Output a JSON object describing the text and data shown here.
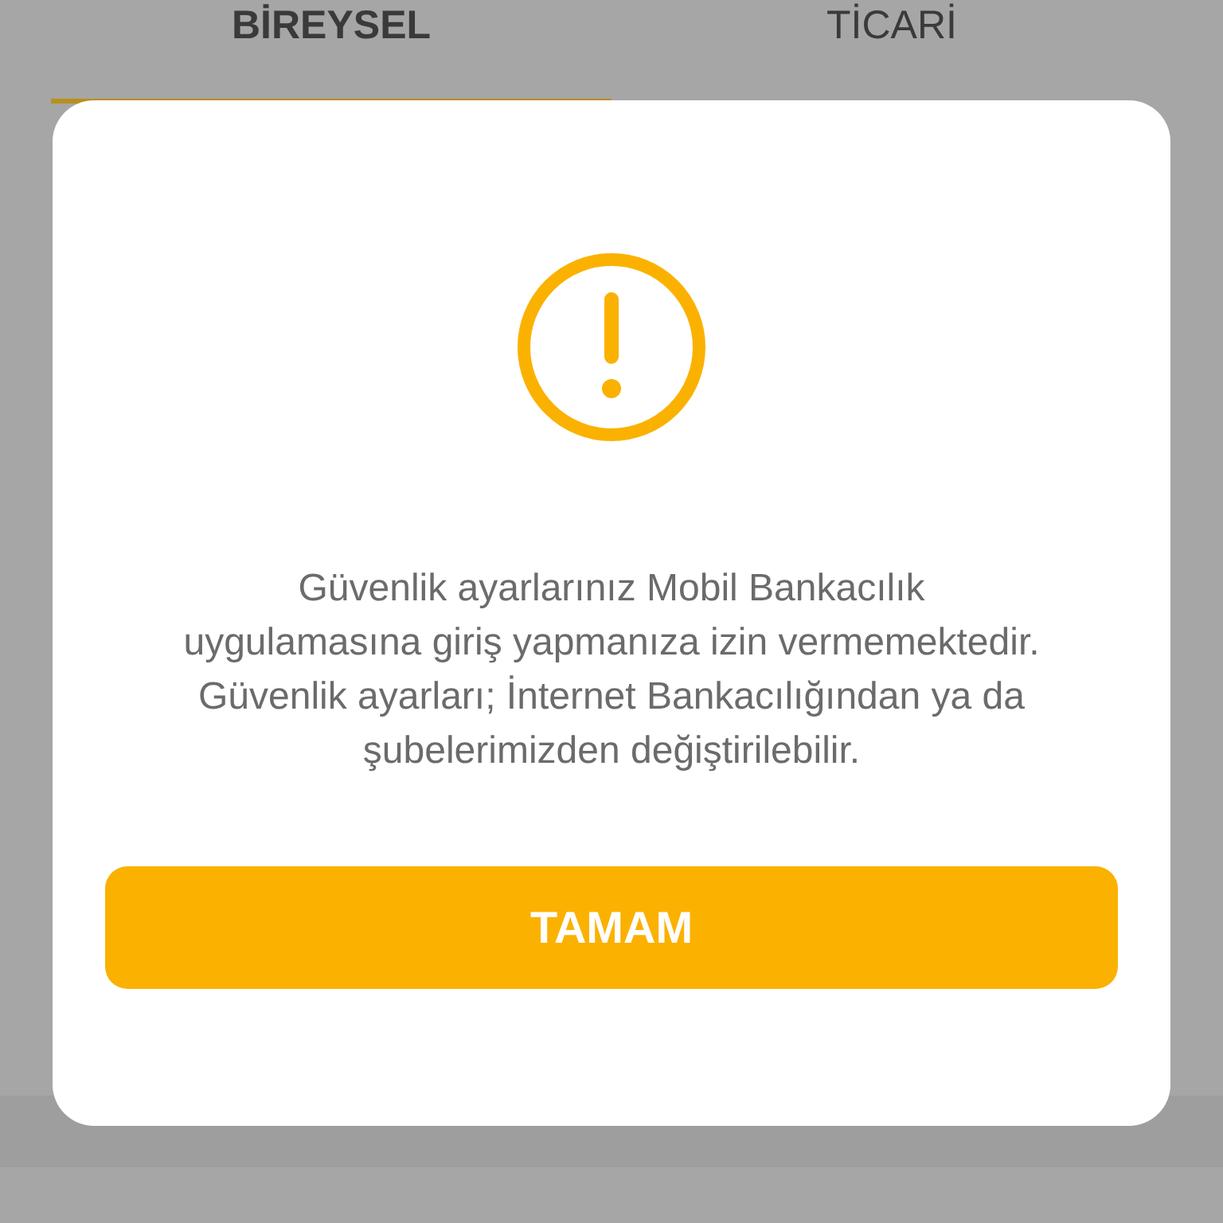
{
  "tabs": [
    {
      "label": "BİREYSEL",
      "selected": true
    },
    {
      "label": "TİCARİ",
      "selected": false
    }
  ],
  "dialog": {
    "message": "Güvenlik ayarlarınız Mobil Bankacılık uygulamasına giriş yapmanıza izin vermemektedir. Güvenlik ayarları; İnternet Bankacılığından ya da şubelerimizden değiştirilebilir.",
    "button": "TAMAM"
  }
}
